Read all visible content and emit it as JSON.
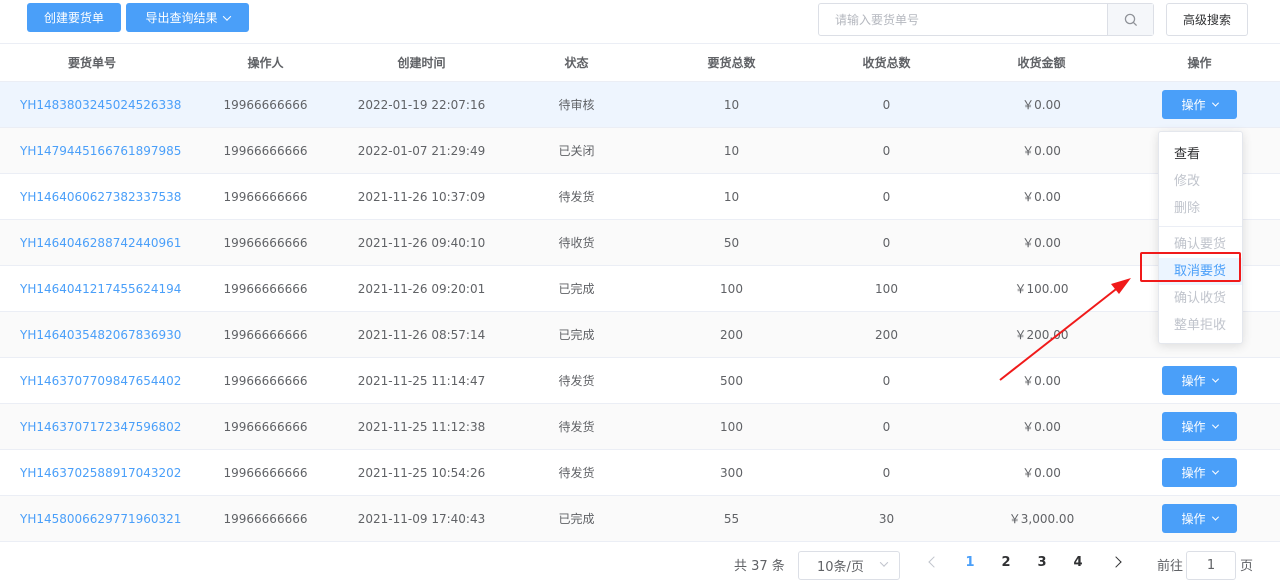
{
  "toolbar": {
    "create_label": "创建要货单",
    "export_label": "导出查询结果",
    "search_placeholder": "请输入要货单号",
    "advanced_label": "高级搜索"
  },
  "table": {
    "headers": [
      "要货单号",
      "操作人",
      "创建时间",
      "状态",
      "要货总数",
      "收货总数",
      "收货金额",
      "操作"
    ],
    "op_label": "操作",
    "rows": [
      {
        "order": "YH1483803245024526338",
        "operator": "19966666666",
        "time": "2022-01-19 22:07:16",
        "status": "待审核",
        "req": "10",
        "recv": "0",
        "amount": "￥0.00"
      },
      {
        "order": "YH1479445166761897985",
        "operator": "19966666666",
        "time": "2022-01-07 21:29:49",
        "status": "已关闭",
        "req": "10",
        "recv": "0",
        "amount": "￥0.00"
      },
      {
        "order": "YH1464060627382337538",
        "operator": "19966666666",
        "time": "2021-11-26 10:37:09",
        "status": "待发货",
        "req": "10",
        "recv": "0",
        "amount": "￥0.00"
      },
      {
        "order": "YH1464046288742440961",
        "operator": "19966666666",
        "time": "2021-11-26 09:40:10",
        "status": "待收货",
        "req": "50",
        "recv": "0",
        "amount": "￥0.00"
      },
      {
        "order": "YH1464041217455624194",
        "operator": "19966666666",
        "time": "2021-11-26 09:20:01",
        "status": "已完成",
        "req": "100",
        "recv": "100",
        "amount": "￥100.00"
      },
      {
        "order": "YH1464035482067836930",
        "operator": "19966666666",
        "time": "2021-11-26 08:57:14",
        "status": "已完成",
        "req": "200",
        "recv": "200",
        "amount": "￥200.00"
      },
      {
        "order": "YH1463707709847654402",
        "operator": "19966666666",
        "time": "2021-11-25 11:14:47",
        "status": "待发货",
        "req": "500",
        "recv": "0",
        "amount": "￥0.00"
      },
      {
        "order": "YH1463707172347596802",
        "operator": "19966666666",
        "time": "2021-11-25 11:12:38",
        "status": "待发货",
        "req": "100",
        "recv": "0",
        "amount": "￥0.00"
      },
      {
        "order": "YH1463702588917043202",
        "operator": "19966666666",
        "time": "2021-11-25 10:54:26",
        "status": "待发货",
        "req": "300",
        "recv": "0",
        "amount": "￥0.00"
      },
      {
        "order": "YH1458006629771960321",
        "operator": "19966666666",
        "time": "2021-11-09 17:40:43",
        "status": "已完成",
        "req": "55",
        "recv": "30",
        "amount": "￥3,000.00"
      }
    ]
  },
  "dropdown": {
    "items": [
      "查看",
      "修改",
      "删除",
      "确认要货",
      "取消要货",
      "确认收货",
      "整单拒收"
    ]
  },
  "pagination": {
    "total": "共 37 条",
    "page_size": "10条/页",
    "pages": [
      "1",
      "2",
      "3",
      "4"
    ],
    "goto_label": "前往",
    "goto_value": "1",
    "goto_unit": "页"
  },
  "colors": {
    "primary": "#4a9ff9",
    "annotation": "#f01a1a"
  }
}
